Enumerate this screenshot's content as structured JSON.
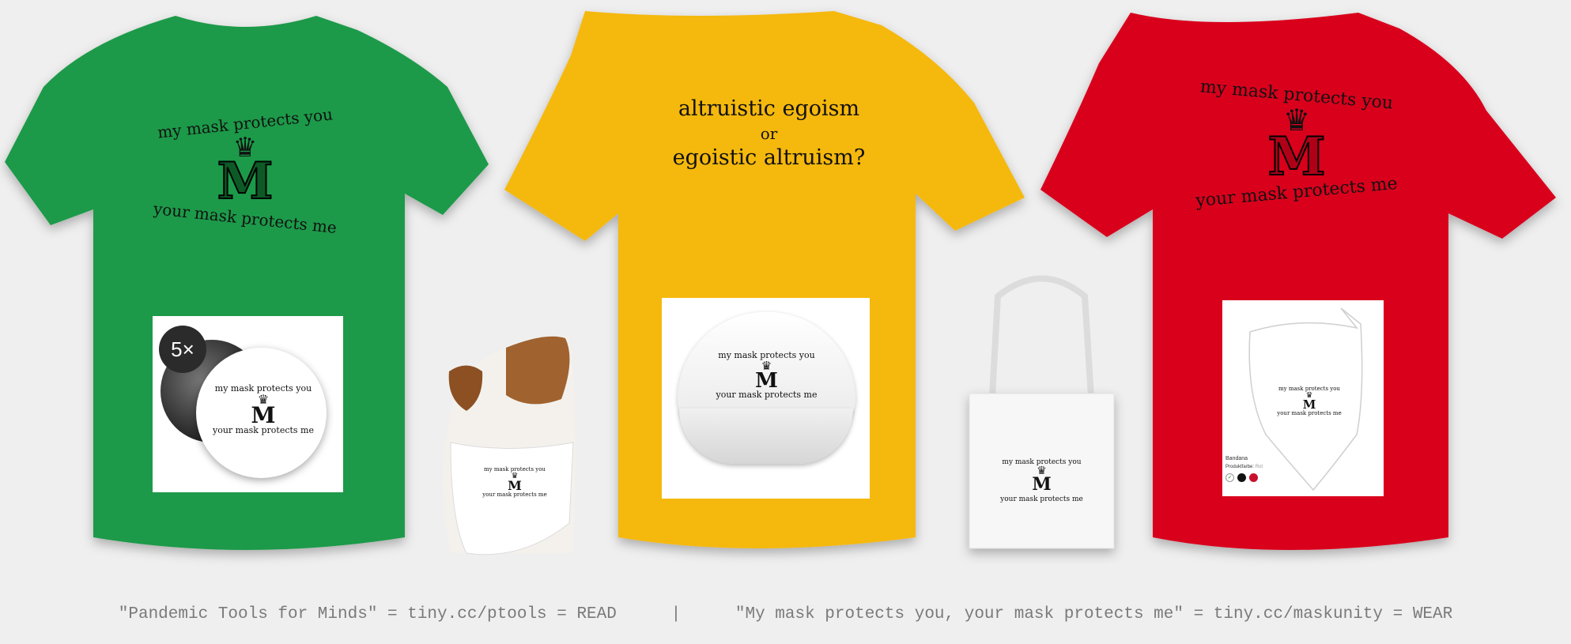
{
  "colors": {
    "background": "#efefef",
    "green_shirt": "#1f9a48",
    "yellow_shirt": "#f5b80c",
    "red_shirt": "#d9001e",
    "print_ink": "#111111",
    "footer_text": "#7a7a7a"
  },
  "products": {
    "green_tshirt": {
      "top_text": "my mask protects you",
      "monogram": "M",
      "bottom_text": "your mask protects me"
    },
    "yellow_tshirt": {
      "line1": "altruistic egoism",
      "line2": "or",
      "line3": "egoistic altruism?"
    },
    "red_tshirt": {
      "top_text": "my mask protects you",
      "monogram": "M",
      "bottom_text": "your mask protects me"
    },
    "buttons_inset": {
      "badge": "5×",
      "top_text": "my mask protects you",
      "monogram": "M",
      "bottom_text": "your mask protects me"
    },
    "dog_bandana": {
      "top_text": "my mask protects you",
      "monogram": "M",
      "bottom_text": "your mask protects me"
    },
    "cap_inset": {
      "top_text": "my mask protects you",
      "monogram": "M",
      "bottom_text": "your mask protects me"
    },
    "tote_bag": {
      "top_text": "my mask protects you",
      "monogram": "M",
      "bottom_text": "your mask protects me"
    },
    "bandana_inset": {
      "top_text": "my mask protects you",
      "monogram": "M",
      "bottom_text": "your mask protects me",
      "product_name": "Bandana",
      "product_color_label": "Produktfarbe:",
      "product_color_value": "Rot",
      "swatches": [
        "#ffffff",
        "#111111",
        "#c8102e"
      ]
    }
  },
  "footer": {
    "left": "\"Pandemic Tools for Minds\" = tiny.cc/ptools = READ",
    "separator": "|",
    "right": "\"My mask protects you, your mask protects me\" = tiny.cc/maskunity = WEAR"
  }
}
